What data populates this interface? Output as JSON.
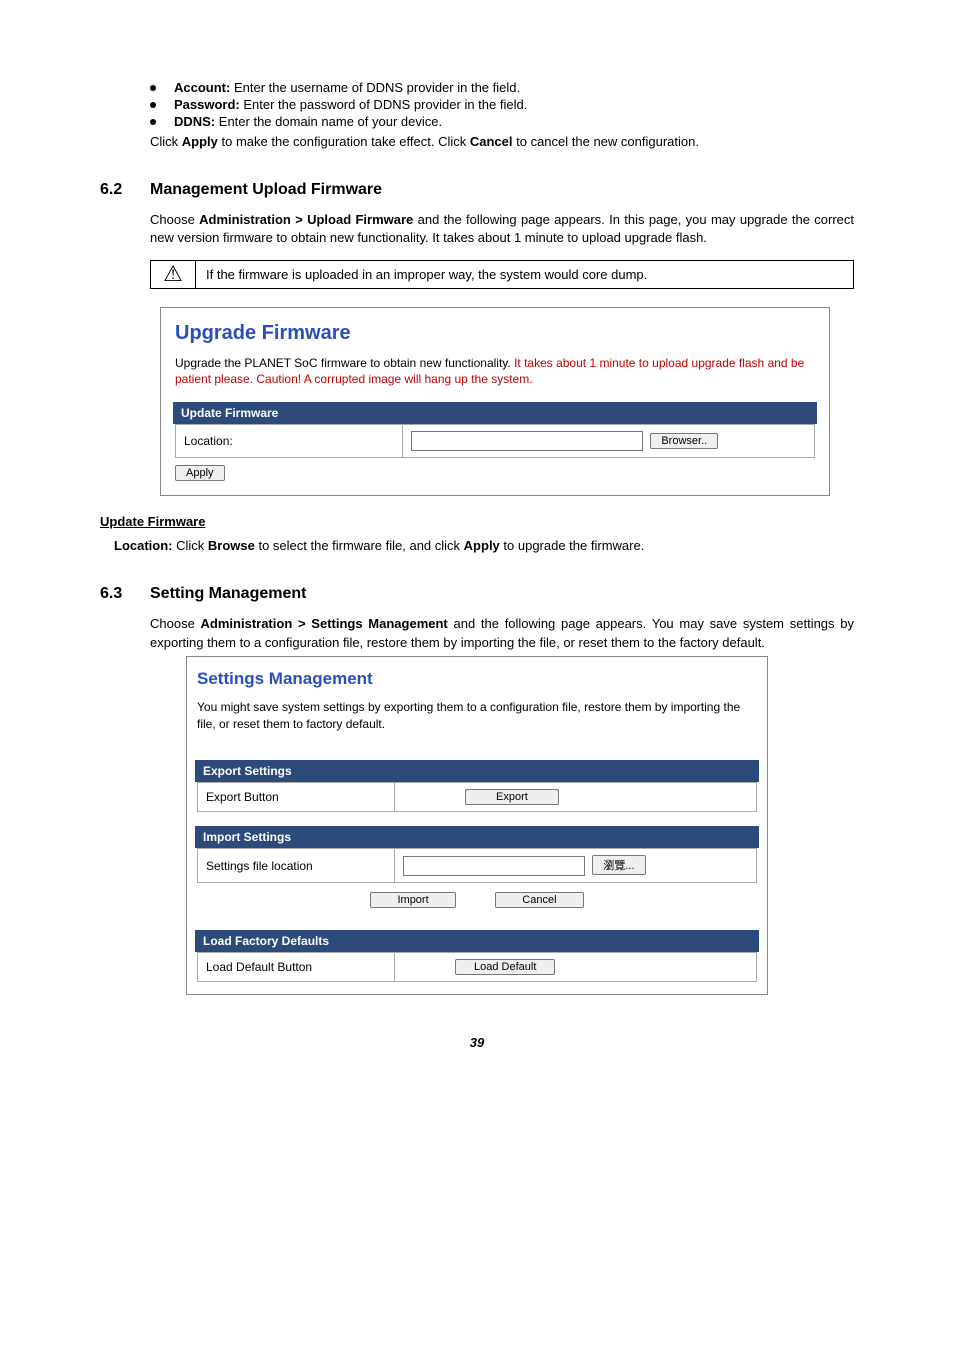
{
  "bullets": {
    "account_label": "Account:",
    "account_text": " Enter the username of DDNS provider in the field.",
    "password_label": "Password:",
    "password_text": " Enter the password of DDNS provider in the field.",
    "ddns_label": "DDNS:",
    "ddns_text": " Enter the domain name of your device."
  },
  "apply_line": {
    "p1": "Click ",
    "b1": "Apply",
    "p2": " to make the configuration take effect. Click ",
    "b2": "Cancel",
    "p3": " to cancel the new configuration."
  },
  "sec62": {
    "num": "6.2",
    "title": "Management Upload Firmware",
    "para_a": "Choose ",
    "para_b": "Administration > Upload Firmware",
    "para_c": " and the following page appears. In this page, you may upgrade the correct new version firmware to obtain new functionality. It takes about 1 minute to upload upgrade flash."
  },
  "warn": "If the firmware is uploaded in an improper way, the system would core dump.",
  "upgrade_panel": {
    "title": "Upgrade Firmware",
    "note_black": "Upgrade the PLANET SoC firmware to obtain new functionality. ",
    "note_red": "It takes about 1 minute to upload   upgrade flash and be patient please. Caution! A corrupted image will hang up the system.",
    "bar": "Update Firmware",
    "loc_label": "Location:",
    "browse": "Browser..",
    "apply": "Apply"
  },
  "update_fw": {
    "heading": "Update Firmware",
    "p1": "Location:",
    "p2": " Click ",
    "b1": "Browse",
    "p3": " to select the firmware file, and click ",
    "b2": "Apply",
    "p4": " to upgrade the firmware."
  },
  "sec63": {
    "num": "6.3",
    "title": "Setting Management",
    "para_a": "Choose ",
    "para_b": "Administration > Settings Management",
    "para_c": " and the following page appears. You may save system settings by exporting them to a configuration file, restore them by importing the file, or reset them to the factory default."
  },
  "settings_panel": {
    "title": "Settings Management",
    "note": "You might save system settings by exporting them to a configuration file, restore them by importing the file, or reset them to factory default.",
    "export_bar": "Export Settings",
    "export_label": "Export Button",
    "export_btn": "Export",
    "import_bar": "Import Settings",
    "import_label": "Settings file location",
    "browse_btn": "瀏覽...",
    "import_btn": "Import",
    "cancel_btn": "Cancel",
    "load_bar": "Load Factory Defaults",
    "load_label": "Load Default Button",
    "load_btn": "Load Default"
  },
  "pagenum": "39"
}
